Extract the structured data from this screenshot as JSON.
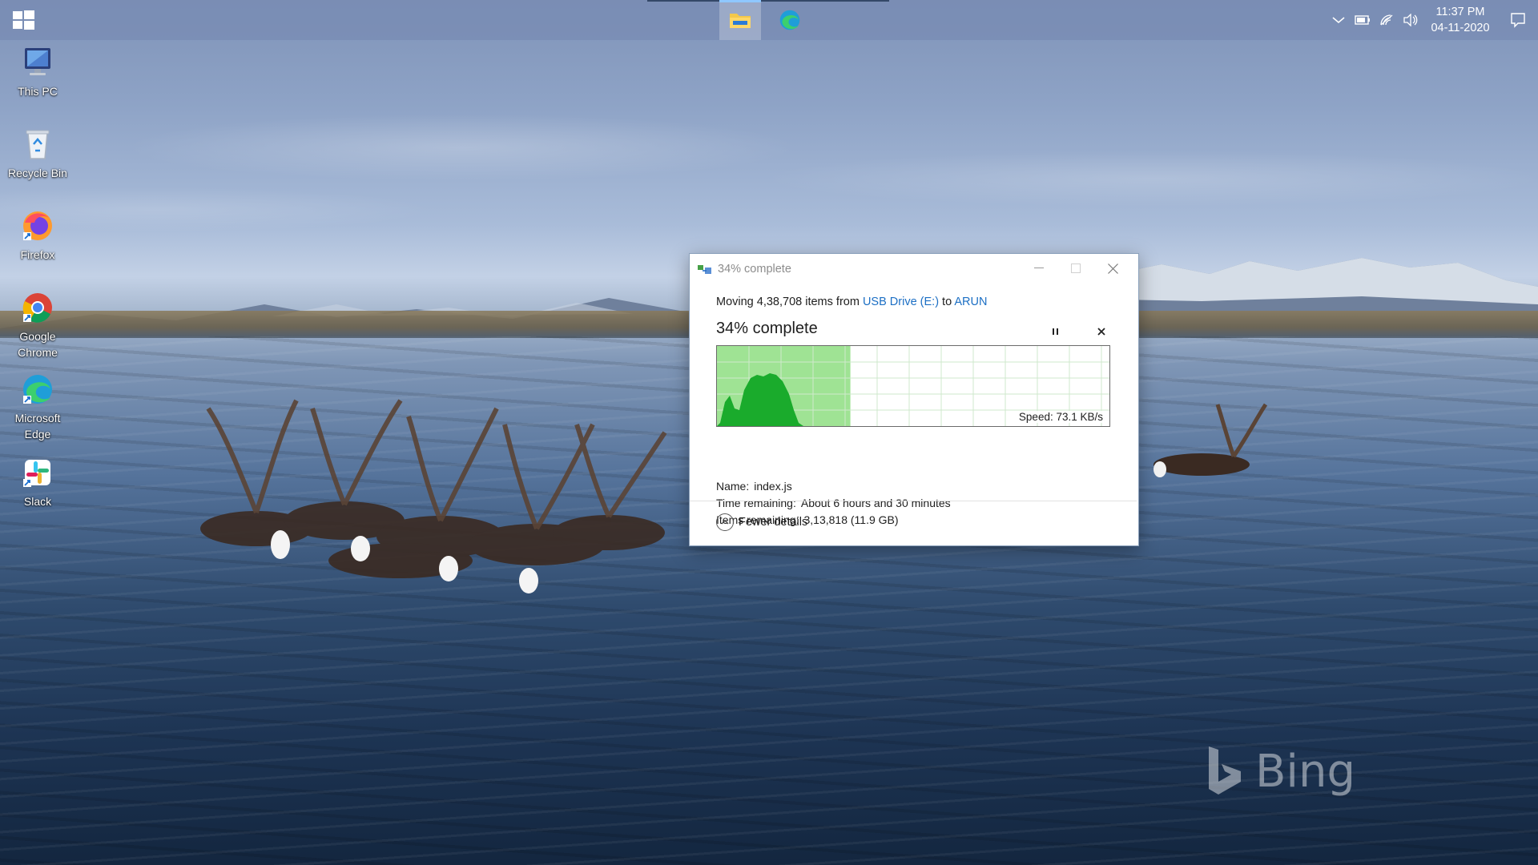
{
  "taskbar": {
    "apps": [
      {
        "name": "File Explorer",
        "icon": "folder-icon",
        "active": true
      },
      {
        "name": "Microsoft Edge",
        "icon": "edge-icon",
        "active": false
      }
    ],
    "tray": {
      "icons": [
        "chevron-up-icon",
        "battery-icon",
        "wifi-icon",
        "volume-icon"
      ],
      "time": "11:37 PM",
      "date": "04-11-2020",
      "notification_icon": "notification-icon"
    }
  },
  "desktop_icons": [
    {
      "label": "This PC",
      "icon": "this-pc-icon"
    },
    {
      "label": "Recycle Bin",
      "icon": "recycle-bin-icon"
    },
    {
      "label": "Firefox",
      "icon": "firefox-icon"
    },
    {
      "label": "Google Chrome",
      "icon": "chrome-icon"
    },
    {
      "label": "Microsoft Edge",
      "icon": "edge-icon"
    },
    {
      "label": "Slack",
      "icon": "slack-icon"
    }
  ],
  "watermark": {
    "text": "Bing"
  },
  "dialog": {
    "title": "34% complete",
    "moving_prefix": "Moving 4,38,708 items from ",
    "source": "USB Drive (E:)",
    "to_word": " to ",
    "destination": "ARUN",
    "percent_text": "34% complete",
    "progress_fraction": 0.34,
    "speed_label": "Speed: 73.1 KB/s",
    "name_label": "Name:",
    "name_value": "index.js",
    "time_label": "Time remaining:",
    "time_value": "About 6 hours and 30 minutes",
    "items_label": "Items remaining:",
    "items_value": "3,13,818 (11.9 GB)",
    "fewer_details": "Fewer details",
    "accent_color": "#06b025",
    "fill_color": "#9fe394"
  }
}
